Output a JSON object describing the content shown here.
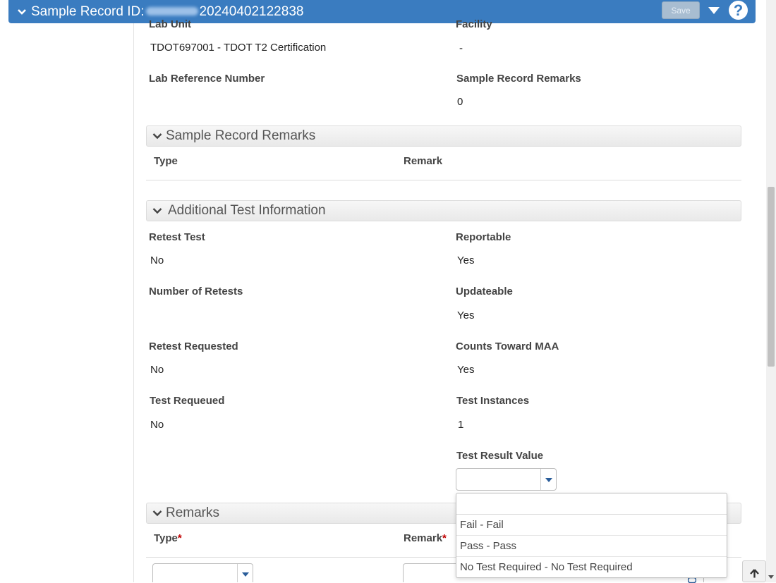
{
  "header": {
    "title_prefix": "Sample Record ID:",
    "record_id": "20240402122838",
    "save_label": "Save",
    "help_label": "?"
  },
  "general": {
    "lab_unit_label": "Lab Unit",
    "lab_unit_value": "TDOT697001 - TDOT T2 Certification",
    "facility_label": "Facility",
    "facility_value": "-",
    "lab_reference_label": "Lab Reference Number",
    "remarks_count_label": "Sample Record Remarks",
    "remarks_count_value": "0"
  },
  "sample_record_remarks": {
    "title": "Sample Record Remarks",
    "col_type": "Type",
    "col_remark": "Remark"
  },
  "additional_test_information": {
    "title": "Additional Test Information",
    "retest_test_label": "Retest Test",
    "retest_test_value": "No",
    "reportable_label": "Reportable",
    "reportable_value": "Yes",
    "number_of_retests_label": "Number of Retests",
    "updateable_label": "Updateable",
    "updateable_value": "Yes",
    "retest_requested_label": "Retest Requested",
    "retest_requested_value": "No",
    "counts_toward_maa_label": "Counts Toward MAA",
    "counts_toward_maa_value": "Yes",
    "test_requeued_label": "Test Requeued",
    "test_requeued_value": "No",
    "test_instances_label": "Test Instances",
    "test_instances_value": "1",
    "test_result_value_label": "Test Result Value",
    "test_result_options": [
      "Fail - Fail",
      "Pass - Pass",
      "No Test Required - No Test Required"
    ]
  },
  "remarks": {
    "title": "Remarks",
    "type_label": "Type",
    "remark_label": "Remark",
    "required_mark": "*"
  },
  "colors": {
    "header_bg": "#3a7cc0",
    "required": "#c00000"
  }
}
